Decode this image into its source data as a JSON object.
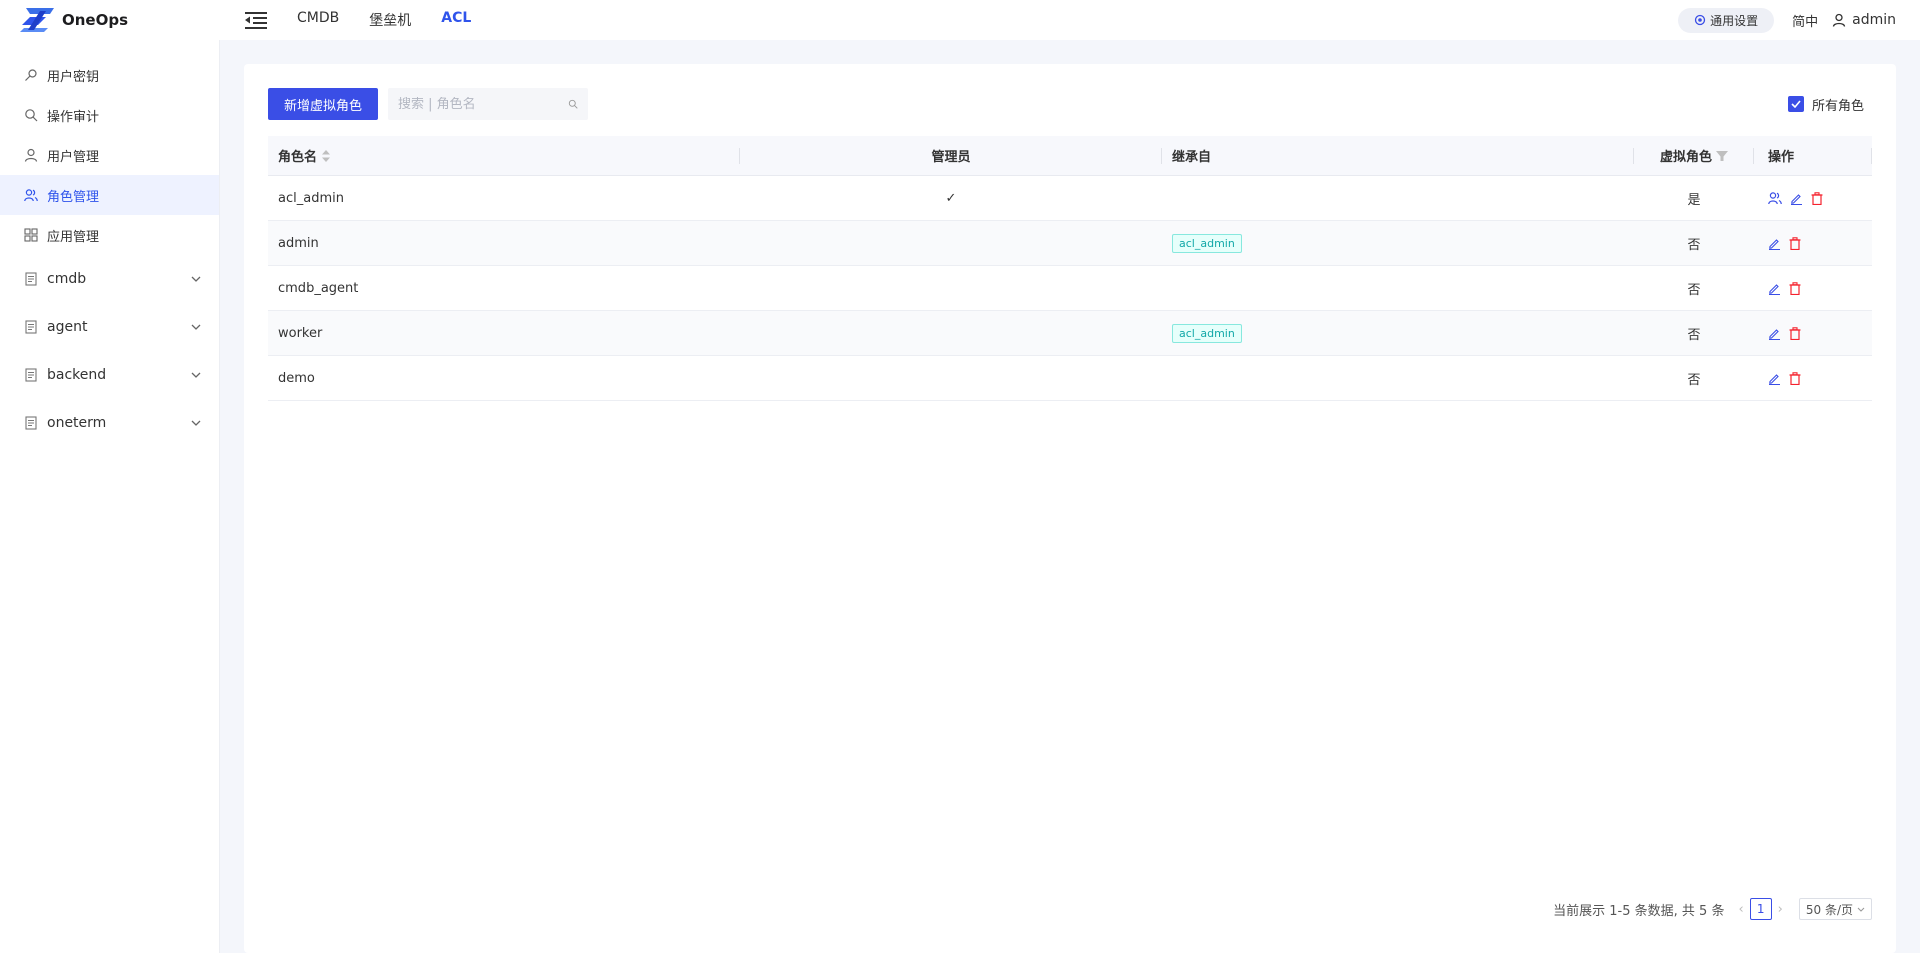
{
  "app": {
    "name": "OneOps"
  },
  "topnav": [
    {
      "label": "CMDB",
      "active": false
    },
    {
      "label": "堡垒机",
      "active": false
    },
    {
      "label": "ACL",
      "active": true
    }
  ],
  "header": {
    "settings_label": "通用设置",
    "lang_label": "简中",
    "user_label": "admin"
  },
  "sidebar": {
    "items": [
      {
        "label": "用户密钥",
        "icon": "key-icon"
      },
      {
        "label": "操作审计",
        "icon": "search-icon"
      },
      {
        "label": "用户管理",
        "icon": "user-icon"
      },
      {
        "label": "角色管理",
        "icon": "role-icon",
        "active": true
      },
      {
        "label": "应用管理",
        "icon": "apps-icon"
      }
    ],
    "groups": [
      {
        "label": "cmdb",
        "icon": "doc-icon"
      },
      {
        "label": "agent",
        "icon": "doc-icon"
      },
      {
        "label": "backend",
        "icon": "doc-icon"
      },
      {
        "label": "oneterm",
        "icon": "doc-icon"
      }
    ]
  },
  "toolbar": {
    "add_label": "新增虚拟角色",
    "search_placeholder": "搜索 | 角色名",
    "all_roles_label": "所有角色"
  },
  "table": {
    "headers": {
      "name": "角色名",
      "admin": "管理员",
      "inherit": "继承自",
      "virtual": "虚拟角色",
      "ops": "操作"
    },
    "rows": [
      {
        "name": "acl_admin",
        "admin_check": "✓",
        "inherit": "",
        "virtual": "是"
      },
      {
        "name": "admin",
        "admin_check": "",
        "inherit": "acl_admin",
        "virtual": "否"
      },
      {
        "name": "cmdb_agent",
        "admin_check": "",
        "inherit": "",
        "virtual": "否"
      },
      {
        "name": "worker",
        "admin_check": "",
        "inherit": "acl_admin",
        "virtual": "否"
      },
      {
        "name": "demo",
        "admin_check": "",
        "inherit": "",
        "virtual": "否"
      }
    ]
  },
  "pager": {
    "summary": "当前展示 1-5 条数据, 共 5 条",
    "current_page": "1",
    "page_size": "50 条/页",
    "prev": "‹",
    "next": "›"
  },
  "colors": {
    "accent": "#3a4ee6",
    "tag_text": "#13a8a8",
    "danger": "#f5222d"
  }
}
